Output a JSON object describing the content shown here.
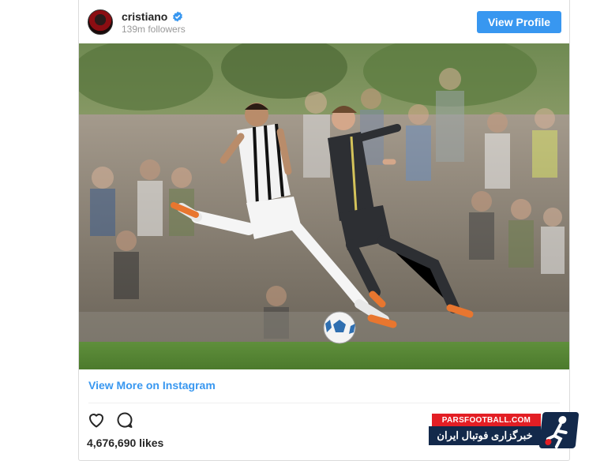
{
  "profile": {
    "username": "cristiano",
    "followers": "139m followers",
    "view_profile_label": "View Profile"
  },
  "post": {
    "view_more_label": "View More on Instagram",
    "likes": "4,676,690 likes"
  },
  "watermark": {
    "top_text": "PARSFOOTBALL.COM",
    "bottom_text": "خبرگزاری فوتبال ایران"
  },
  "colors": {
    "accent": "#3897f0",
    "text": "#262626",
    "muted": "#999999",
    "border": "#dbdbdb",
    "watermark_red": "#e31e24",
    "watermark_navy": "#13294b"
  },
  "icons": [
    "verified-badge-icon",
    "heart-icon",
    "comment-icon",
    "parsfootball-logo-icon"
  ]
}
